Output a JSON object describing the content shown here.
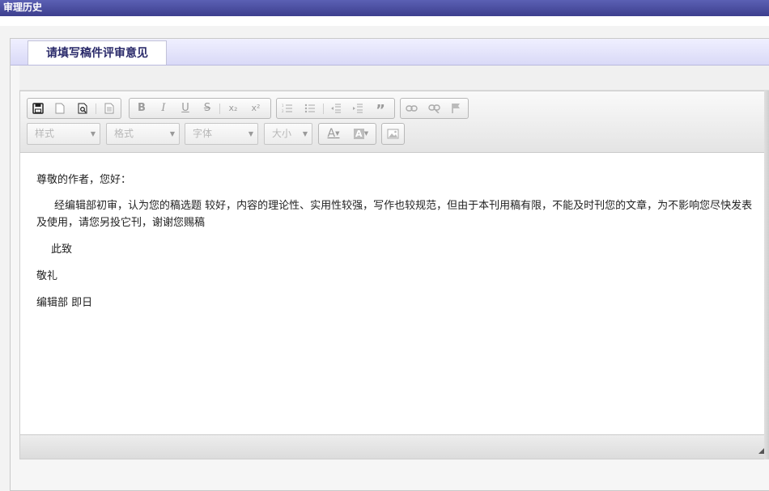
{
  "window": {
    "title": "审理历史"
  },
  "tab": {
    "label": "请填写稿件评审意见"
  },
  "toolbar": {
    "group1": [
      {
        "name": "save-icon",
        "glyph": "🖫",
        "active": true
      },
      {
        "name": "new-page-icon",
        "glyph": "🗋",
        "active": false
      },
      {
        "name": "preview-icon",
        "glyph": "🔍",
        "active": true
      },
      {
        "name": "templates-icon",
        "glyph": "☷",
        "active": false
      }
    ],
    "group2": [
      {
        "name": "bold-icon",
        "glyph": "B",
        "active": false
      },
      {
        "name": "italic-icon",
        "glyph": "I",
        "active": false
      },
      {
        "name": "underline-icon",
        "glyph": "U",
        "active": false
      },
      {
        "name": "strikethrough-icon",
        "glyph": "S",
        "active": false
      },
      {
        "name": "subscript-icon",
        "glyph": "x₂",
        "active": false
      },
      {
        "name": "superscript-icon",
        "glyph": "x²",
        "active": false
      }
    ],
    "group3": [
      {
        "name": "numbered-list-icon",
        "glyph": "☰",
        "active": false
      },
      {
        "name": "bulleted-list-icon",
        "glyph": "∷",
        "active": false
      },
      {
        "name": "decrease-indent-icon",
        "glyph": "⇤",
        "active": false
      },
      {
        "name": "increase-indent-icon",
        "glyph": "⇥",
        "active": false
      },
      {
        "name": "blockquote-icon",
        "glyph": "”",
        "active": false
      }
    ],
    "group4": [
      {
        "name": "link-icon",
        "glyph": "∞",
        "active": false
      },
      {
        "name": "unlink-icon",
        "glyph": "⊘",
        "active": false
      },
      {
        "name": "anchor-flag-icon",
        "glyph": "⚑",
        "active": false
      }
    ],
    "combos": {
      "styles": "样式",
      "format": "格式",
      "font": "字体",
      "size": "大小"
    },
    "text_color_glyph": "A",
    "bg_color_glyph": "A",
    "image_glyph": "▨"
  },
  "content": {
    "greeting": "尊敬的作者，您好：",
    "body_line1": "经编辑部初审，认为您的稿选题 较好，内容的理论性、实用性较强，写作也较规范，但由于本刊用稿有限，不能及时刊您的文章，为不影响您尽快发表",
    "body_line2": "及使用，请您另投它刊，谢谢您赐稿",
    "closing1": "此致",
    "closing2": "敬礼",
    "signature": "编辑部  即日"
  }
}
